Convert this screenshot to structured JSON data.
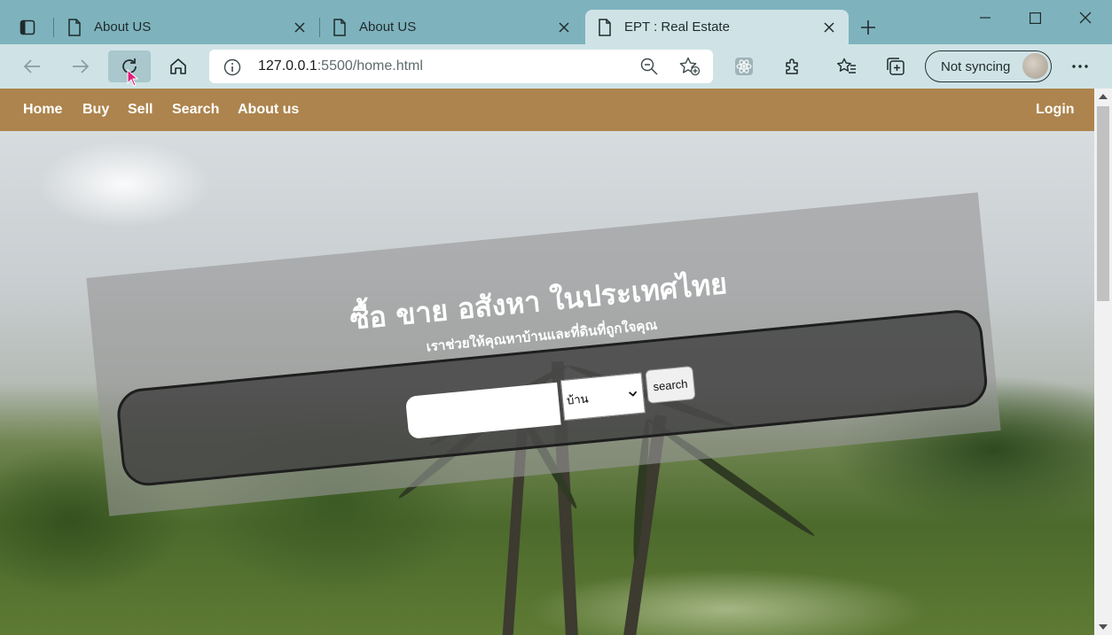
{
  "browser": {
    "tabs": [
      {
        "title": "About US",
        "active": false
      },
      {
        "title": "About US",
        "active": false
      },
      {
        "title": "EPT : Real Estate",
        "active": true
      }
    ],
    "address": {
      "host": "127.0.0.1",
      "path": ":5500/home.html"
    },
    "profile_label": "Not syncing",
    "icons": {
      "tab_actions": "tab-actions-icon",
      "page": "page-icon",
      "back": "back-arrow-icon",
      "forward": "forward-arrow-icon",
      "refresh": "refresh-icon",
      "home": "home-icon",
      "info": "info-icon",
      "zoom": "zoom-out-icon",
      "add_favorite": "star-add-icon",
      "extension_react": "react-devtools-icon",
      "extensions": "puzzle-icon",
      "favorites": "favorites-icon",
      "collections": "collections-icon",
      "more": "more-icon"
    }
  },
  "site": {
    "nav": {
      "home": "Home",
      "buy": "Buy",
      "sell": "Sell",
      "search": "Search",
      "about": "About us",
      "login": "Login"
    },
    "hero": {
      "title": "ซื้อ ขาย อสังหา ในประเทศไทย",
      "subtitle": "เราช่วยให้คุณหาบ้านและที่ดินที่ถูกใจคุณ",
      "search_value": "",
      "select_value": "บ้าน",
      "search_button": "search"
    },
    "colors": {
      "nav_bg": "#ad844d",
      "chrome_bg": "#7eb3bd",
      "toolbar_bg": "#cfe3e6"
    }
  }
}
